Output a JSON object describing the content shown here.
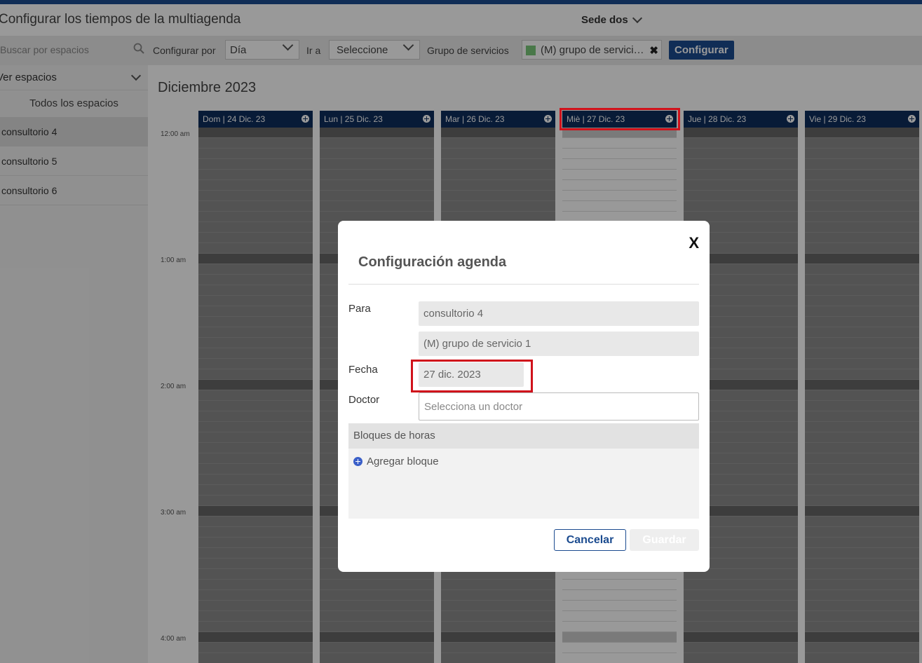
{
  "header": {
    "title": "Configurar los tiempos de la multiagenda",
    "sede": "Sede dos"
  },
  "toolbar": {
    "search_placeholder": "Buscar por espacios",
    "configurar_por_label": "Configurar por",
    "configurar_por_value": "Día",
    "ir_a_label": "Ir a",
    "ir_a_value": "Seleccione",
    "grupo_label": "Grupo de servicios",
    "grupo_chip": "(M) grupo de servicio 1",
    "grupo_chip_color": "#7ac97a",
    "configurar_button": "Configurar"
  },
  "sidebar": {
    "header": "Ver espacios",
    "all_label": "Todos los espacios",
    "items": [
      {
        "label": "consultorio 4",
        "active": true
      },
      {
        "label": "consultorio 5",
        "active": false
      },
      {
        "label": "consultorio 6",
        "active": false
      }
    ]
  },
  "calendar": {
    "month": "Diciembre 2023",
    "times": [
      "12:00 am",
      "1:00 am",
      "2:00 am",
      "3:00 am",
      "4:00 am"
    ],
    "days": [
      "Dom | 24 Dic. 23",
      "Lun | 25 Dic. 23",
      "Mar | 26 Dic. 23",
      "Miè | 27 Dic. 23",
      "Jue | 28 Dic. 23",
      "Vie | 29 Dic. 23"
    ],
    "highlighted_day": "Miè | 27 Dic. 23"
  },
  "modal": {
    "title": "Configuración agenda",
    "close": "X",
    "para_label": "Para",
    "para_value": "consultorio 4",
    "grupo_value": "(M) grupo de servicio 1",
    "fecha_label": "Fecha",
    "fecha_value": "27 dic. 2023",
    "doctor_label": "Doctor",
    "doctor_placeholder": "Selecciona un doctor",
    "bloques_label": "Bloques de horas",
    "agregar_label": "Agregar bloque",
    "cancel_button": "Cancelar",
    "save_button": "Guardar"
  },
  "colors": {
    "primary": "#1b4b8f",
    "column_header": "#0e2d5c",
    "highlight": "#d0121b"
  }
}
